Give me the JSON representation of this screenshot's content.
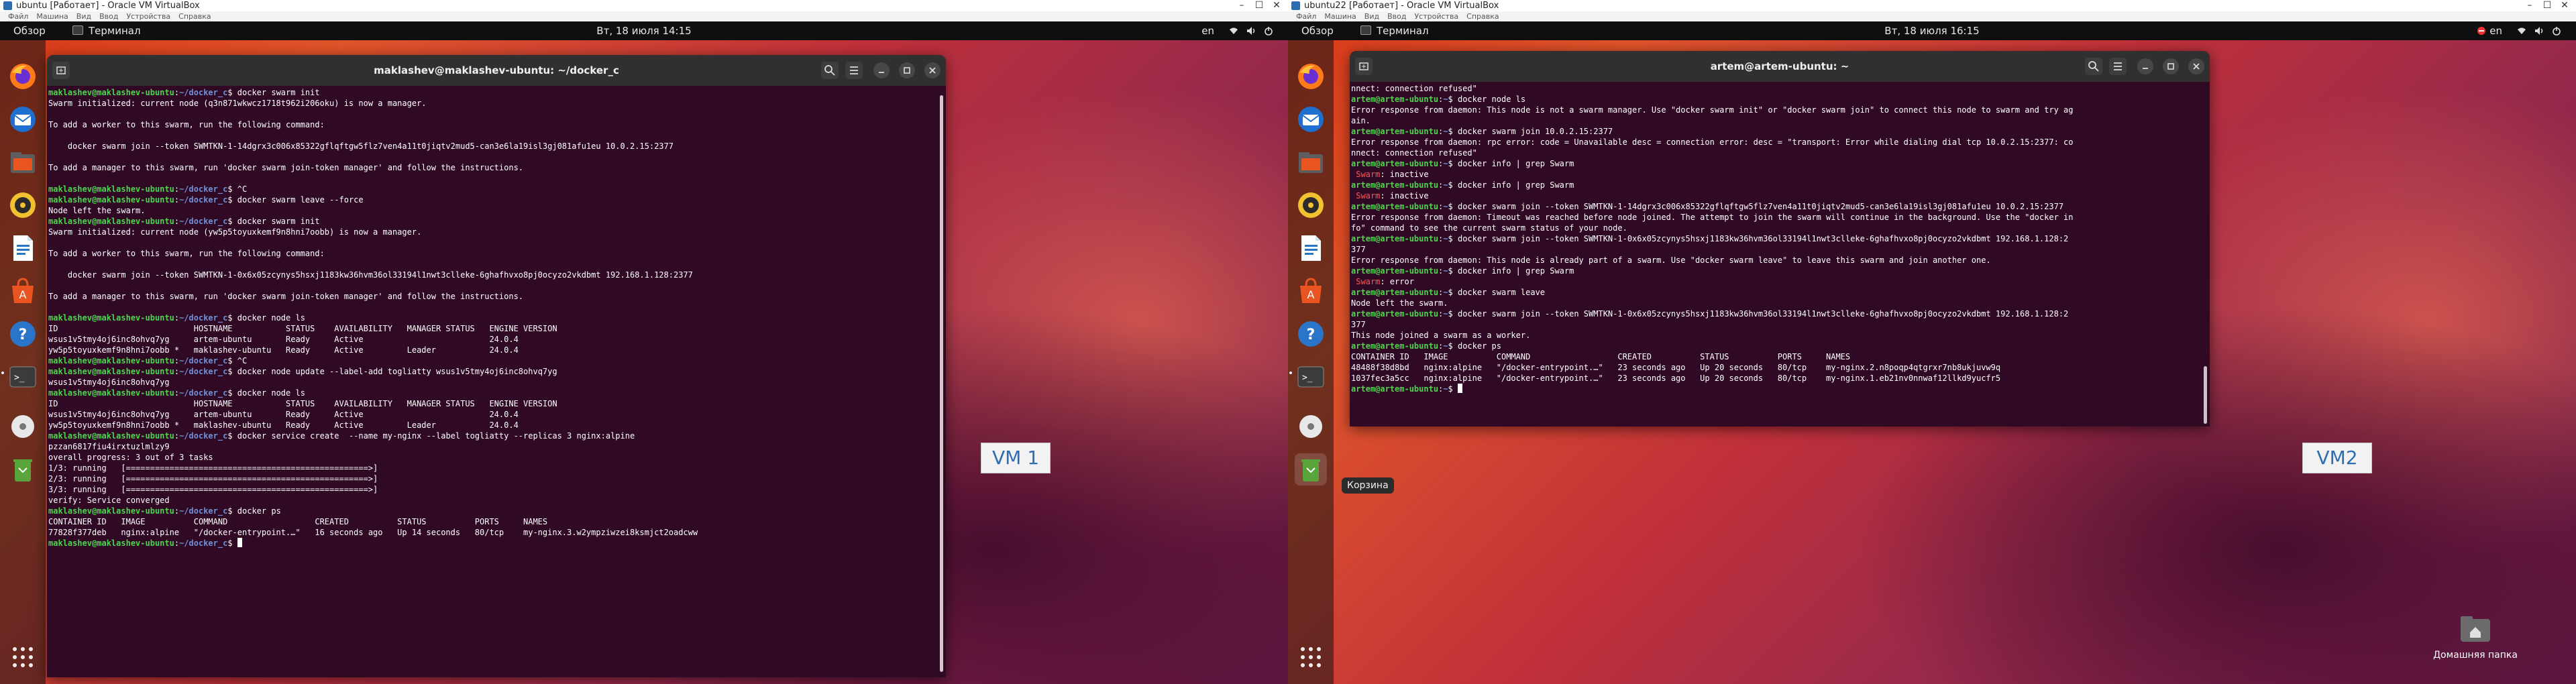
{
  "vm1": {
    "window_title": "ubuntu [Работает] - Oracle VM VirtualBox",
    "menu": [
      "Файл",
      "Машина",
      "Вид",
      "Ввод",
      "Устройства",
      "Справка"
    ],
    "topbar": {
      "activities": "Обзор",
      "app": "Терминал",
      "clock": "Вт, 18 июля 14:15",
      "lang": "en"
    },
    "terminal_title": "maklashev@maklashev-ubuntu: ~/docker_c",
    "user": "maklashev@maklashev-ubuntu",
    "path": "~/docker_c",
    "label": "VM 1",
    "lines": [
      {
        "t": "cmd",
        "cmd": "docker swarm init"
      },
      {
        "t": "out",
        "text": "Swarm initialized: current node (q3n871wkwcz1718t962i206oku) is now a manager."
      },
      {
        "t": "out",
        "text": ""
      },
      {
        "t": "out",
        "text": "To add a worker to this swarm, run the following command:"
      },
      {
        "t": "out",
        "text": ""
      },
      {
        "t": "out",
        "text": "    docker swarm join --token SWMTKN-1-14dgrx3c006x85322gflqftgw5flz7ven4a11t0jiqtv2mud5-can3e6la19isl3gj081afu1eu 10.0.2.15:2377"
      },
      {
        "t": "out",
        "text": ""
      },
      {
        "t": "out",
        "text": "To add a manager to this swarm, run 'docker swarm join-token manager' and follow the instructions."
      },
      {
        "t": "out",
        "text": ""
      },
      {
        "t": "cmd",
        "cmd": "^C"
      },
      {
        "t": "cmd",
        "cmd": "docker swarm leave --force"
      },
      {
        "t": "out",
        "text": "Node left the swarm."
      },
      {
        "t": "cmd",
        "cmd": "docker swarm init"
      },
      {
        "t": "out",
        "text": "Swarm initialized: current node (yw5p5toyuxkemf9n8hni7oobb) is now a manager."
      },
      {
        "t": "out",
        "text": ""
      },
      {
        "t": "out",
        "text": "To add a worker to this swarm, run the following command:"
      },
      {
        "t": "out",
        "text": ""
      },
      {
        "t": "out",
        "text": "    docker swarm join --token SWMTKN-1-0x6x05zcynys5hsxj1183kw36hvm36ol33194l1nwt3clleke-6ghafhvxo8pj0ocyzo2vkdbmt 192.168.1.128:2377"
      },
      {
        "t": "out",
        "text": ""
      },
      {
        "t": "out",
        "text": "To add a manager to this swarm, run 'docker swarm join-token manager' and follow the instructions."
      },
      {
        "t": "out",
        "text": ""
      },
      {
        "t": "cmd",
        "cmd": "docker node ls"
      },
      {
        "t": "out",
        "text": "ID                            HOSTNAME           STATUS    AVAILABILITY   MANAGER STATUS   ENGINE VERSION"
      },
      {
        "t": "out",
        "text": "wsus1v5tmy4oj6inc8ohvq7yg     artem-ubuntu       Ready     Active                          24.0.4"
      },
      {
        "t": "out",
        "text": "yw5p5toyuxkemf9n8hni7oobb *   maklashev-ubuntu   Ready     Active         Leader           24.0.4"
      },
      {
        "t": "cmd",
        "cmd": "^C"
      },
      {
        "t": "cmd",
        "cmd": "docker node update --label-add togliatty wsus1v5tmy4oj6inc8ohvq7yg"
      },
      {
        "t": "out",
        "text": "wsus1v5tmy4oj6inc8ohvq7yg"
      },
      {
        "t": "cmd",
        "cmd": "docker node ls"
      },
      {
        "t": "out",
        "text": "ID                            HOSTNAME           STATUS    AVAILABILITY   MANAGER STATUS   ENGINE VERSION"
      },
      {
        "t": "out",
        "text": "wsus1v5tmy4oj6inc8ohvq7yg     artem-ubuntu       Ready     Active                          24.0.4"
      },
      {
        "t": "out",
        "text": "yw5p5toyuxkemf9n8hni7oobb *   maklashev-ubuntu   Ready     Active         Leader           24.0.4"
      },
      {
        "t": "cmd",
        "cmd": "docker service create  --name my-nginx --label togliatty --replicas 3 nginx:alpine"
      },
      {
        "t": "out",
        "text": "pzzan6817fiu4irxtuzlmlzy9"
      },
      {
        "t": "out",
        "text": "overall progress: 3 out of 3 tasks"
      },
      {
        "t": "out",
        "text": "1/3: running   [==================================================>]"
      },
      {
        "t": "out",
        "text": "2/3: running   [==================================================>]"
      },
      {
        "t": "out",
        "text": "3/3: running   [==================================================>]"
      },
      {
        "t": "out",
        "text": "verify: Service converged"
      },
      {
        "t": "cmd",
        "cmd": "docker ps"
      },
      {
        "t": "out",
        "text": "CONTAINER ID   IMAGE          COMMAND                  CREATED          STATUS          PORTS     NAMES"
      },
      {
        "t": "out",
        "text": "77828f377deb   nginx:alpine   \"/docker-entrypoint.…\"   16 seconds ago   Up 14 seconds   80/tcp    my-nginx.3.w2ympziwzei8ksmjct2oadcww"
      },
      {
        "t": "prompt"
      }
    ]
  },
  "vm2": {
    "window_title": "ubuntu22 [Работает] - Oracle VM VirtualBox",
    "menu": [
      "Файл",
      "Машина",
      "Вид",
      "Ввод",
      "Устройства",
      "Справка"
    ],
    "topbar": {
      "activities": "Обзор",
      "app": "Терминал",
      "clock": "Вт, 18 июля 16:15",
      "lang": "en"
    },
    "terminal_title": "artem@artem-ubuntu: ~",
    "user": "artem@artem-ubuntu",
    "path": "~",
    "label": "VM2",
    "tooltip": "Корзина",
    "desktop_folder": "Домашняя папка",
    "lines": [
      {
        "t": "out",
        "text": "nnect: connection refused\""
      },
      {
        "t": "cmd",
        "cmd": "docker node ls"
      },
      {
        "t": "out",
        "text": "Error response from daemon: This node is not a swarm manager. Use \"docker swarm init\" or \"docker swarm join\" to connect this node to swarm and try ag"
      },
      {
        "t": "out",
        "text": "ain."
      },
      {
        "t": "cmd",
        "cmd": "docker swarm join 10.0.2.15:2377"
      },
      {
        "t": "out",
        "text": "Error response from daemon: rpc error: code = Unavailable desc = connection error: desc = \"transport: Error while dialing dial tcp 10.0.2.15:2377: co"
      },
      {
        "t": "out",
        "text": "nnect: connection refused\""
      },
      {
        "t": "cmd",
        "cmd": "docker info | grep Swarm"
      },
      {
        "t": "kv",
        "key": " Swarm",
        "val": ": inactive"
      },
      {
        "t": "cmd",
        "cmd": "docker info | grep Swarm"
      },
      {
        "t": "kv",
        "key": " Swarm",
        "val": ": inactive"
      },
      {
        "t": "cmd",
        "cmd": "docker swarm join --token SWMTKN-1-14dgrx3c006x85322gflqftgw5flz7ven4a11t0jiqtv2mud5-can3e6la19isl3gj081afu1eu 10.0.2.15:2377"
      },
      {
        "t": "out",
        "text": "Error response from daemon: Timeout was reached before node joined. The attempt to join the swarm will continue in the background. Use the \"docker in"
      },
      {
        "t": "out",
        "text": "fo\" command to see the current swarm status of your node."
      },
      {
        "t": "cmd",
        "cmd": "docker swarm join --token SWMTKN-1-0x6x05zcynys5hsxj1183kw36hvm36ol33194l1nwt3clleke-6ghafhvxo8pj0ocyzo2vkdbmt 192.168.1.128:2"
      },
      {
        "t": "out",
        "text": "377"
      },
      {
        "t": "out",
        "text": "Error response from daemon: This node is already part of a swarm. Use \"docker swarm leave\" to leave this swarm and join another one."
      },
      {
        "t": "cmd",
        "cmd": "docker info | grep Swarm"
      },
      {
        "t": "kv",
        "key": " Swarm",
        "val": ": error"
      },
      {
        "t": "cmd",
        "cmd": "docker swarm leave"
      },
      {
        "t": "out",
        "text": "Node left the swarm."
      },
      {
        "t": "cmd",
        "cmd": "docker swarm join --token SWMTKN-1-0x6x05zcynys5hsxj1183kw36hvm36ol33194l1nwt3clleke-6ghafhvxo8pj0ocyzo2vkdbmt 192.168.1.128:2"
      },
      {
        "t": "out",
        "text": "377"
      },
      {
        "t": "out",
        "text": "This node joined a swarm as a worker."
      },
      {
        "t": "cmd",
        "cmd": "docker ps"
      },
      {
        "t": "out",
        "text": "CONTAINER ID   IMAGE          COMMAND                  CREATED          STATUS          PORTS     NAMES"
      },
      {
        "t": "out",
        "text": "48488f38d8bd   nginx:alpine   \"/docker-entrypoint.…\"   23 seconds ago   Up 20 seconds   80/tcp    my-nginx.2.n8poqp4qtgrxr7nb8ukjuvw9q"
      },
      {
        "t": "out",
        "text": "1037fec3a5cc   nginx:alpine   \"/docker-entrypoint.…\"   23 seconds ago   Up 20 seconds   80/tcp    my-nginx.1.eb21nv0nnwaf12llkd9yucfr5"
      },
      {
        "t": "prompt"
      }
    ]
  },
  "dock_icons": [
    "firefox-icon",
    "thunderbird-icon",
    "files-icon",
    "rhythmbox-icon",
    "writer-icon",
    "app-center-icon",
    "help-icon",
    "terminal-icon",
    "disc-icon",
    "trash-icon",
    "show-apps-icon"
  ],
  "colors": {
    "terminal_bg": "#300a24",
    "prompt_user": "#4fd34f",
    "prompt_path": "#6f8fd8",
    "swarm_key": "#ff5555",
    "header_bg": "#303030",
    "topbar_bg": "#0f0f0f",
    "vm_label_text": "#2d6eb3"
  }
}
